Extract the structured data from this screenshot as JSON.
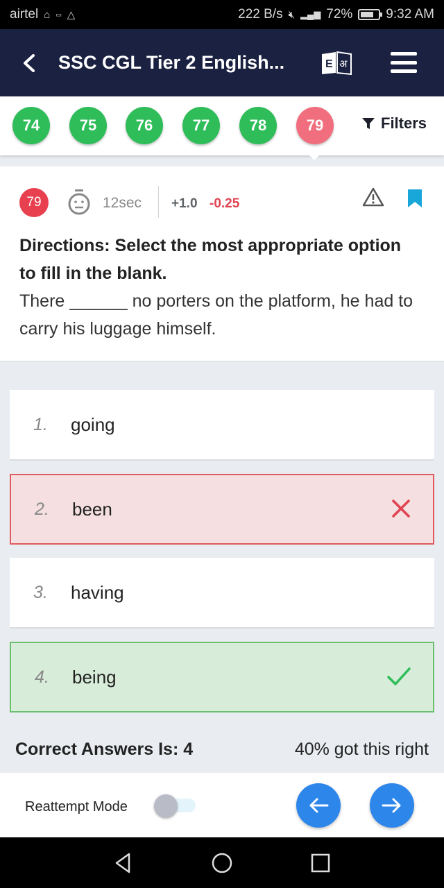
{
  "status_bar": {
    "carrier": "airtel",
    "network_speed": "222 B/s",
    "signal": "4G",
    "battery": "72%",
    "battery_level": 0.72,
    "time": "9:32 AM"
  },
  "app_bar": {
    "title": "SSC CGL Tier 2 English...",
    "language_toggle": "E अ"
  },
  "question_numbers": [
    {
      "number": "74",
      "status": "correct",
      "color": "#2ebd59"
    },
    {
      "number": "75",
      "status": "correct",
      "color": "#2ebd59"
    },
    {
      "number": "76",
      "status": "correct",
      "color": "#2ebd59"
    },
    {
      "number": "77",
      "status": "correct",
      "color": "#2ebd59"
    },
    {
      "number": "78",
      "status": "correct",
      "color": "#2ebd59"
    },
    {
      "number": "79",
      "status": "incorrect",
      "color": "#f06e7e"
    }
  ],
  "filters_label": "Filters",
  "question": {
    "number": "79",
    "time_taken": "12sec",
    "positive_marks": "+1.0",
    "negative_marks": "-0.25",
    "directions": "Directions: Select the most appropriate option to fill in the blank.",
    "text": "There ______ no porters on the platform, he had to carry his luggage himself."
  },
  "options": [
    {
      "index": "1.",
      "text": "going",
      "state": "neutral"
    },
    {
      "index": "2.",
      "text": "been",
      "state": "wrong"
    },
    {
      "index": "3.",
      "text": "having",
      "state": "neutral"
    },
    {
      "index": "4.",
      "text": "being",
      "state": "correct"
    }
  ],
  "result": {
    "correct_answer": "Correct Answers Is: 4",
    "stats": "40% got this right"
  },
  "bottom_bar": {
    "reattempt_label": "Reattempt Mode",
    "reattempt_on": false
  },
  "colors": {
    "header": "#1b2140",
    "correct": "#2ebd59",
    "wrong": "#e04250",
    "accent_blue": "#2d86ea",
    "bookmark": "#19a7d9"
  }
}
